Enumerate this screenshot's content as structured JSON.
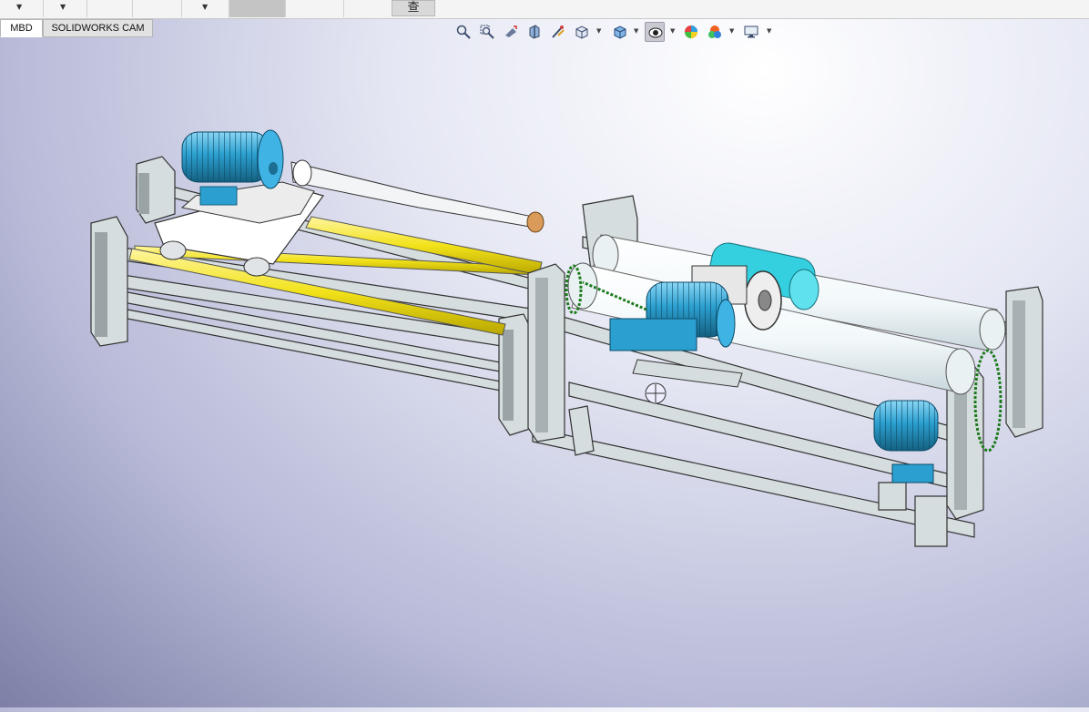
{
  "window": {
    "top_toolbar_glyph": "查"
  },
  "tabs": [
    {
      "label": "MBD",
      "active": true
    },
    {
      "label": "SOLIDWORKS CAM",
      "active": false
    }
  ],
  "heads_up_toolbar": [
    {
      "icon": "zoom-to-fit-icon"
    },
    {
      "icon": "zoom-to-area-icon"
    },
    {
      "icon": "previous-view-icon"
    },
    {
      "icon": "section-view-icon"
    },
    {
      "icon": "dynamic-annotation-views-icon"
    },
    {
      "icon": "view-orientation-icon"
    },
    {
      "icon": "display-style-icon"
    },
    {
      "icon": "hide-show-items-icon"
    },
    {
      "icon": "edit-appearance-icon"
    },
    {
      "icon": "apply-scene-icon"
    },
    {
      "icon": "view-settings-icon"
    }
  ],
  "viewport": {
    "content": "3D assembly model of a roller machine",
    "colors": {
      "motor": "#2b9fcf",
      "frame": "#d6ddde",
      "rail": "#f2e21a",
      "roller": "#f4fafb",
      "accent": "#35d0e0"
    }
  }
}
